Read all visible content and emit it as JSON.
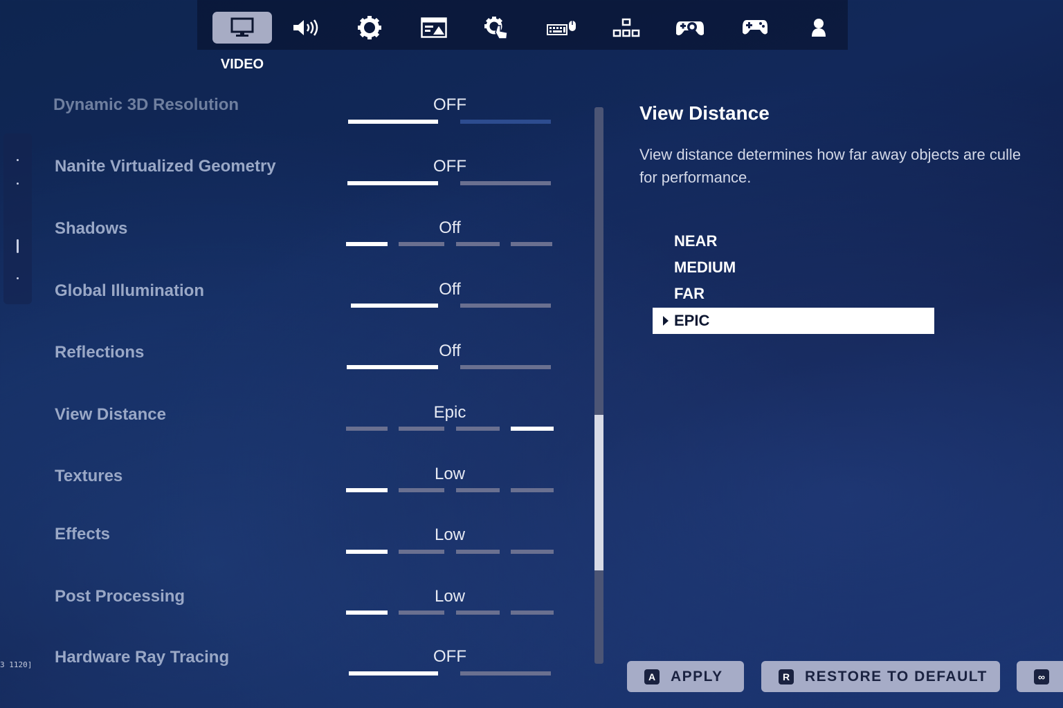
{
  "tabs": {
    "active_label": "VIDEO",
    "items": [
      {
        "icon": "monitor-icon",
        "active": true
      },
      {
        "icon": "speaker-icon",
        "active": false
      },
      {
        "icon": "gear-icon",
        "active": false
      },
      {
        "icon": "display-panel-icon",
        "active": false
      },
      {
        "icon": "touch-gear-icon",
        "active": false
      },
      {
        "icon": "keyboard-mouse-icon",
        "active": false
      },
      {
        "icon": "network-icon",
        "active": false
      },
      {
        "icon": "controller-gear-icon",
        "active": false
      },
      {
        "icon": "gamepad-icon",
        "active": false
      },
      {
        "icon": "account-icon",
        "active": false
      }
    ]
  },
  "settings": [
    {
      "label": "Dynamic 3D Resolution",
      "value": "OFF"
    },
    {
      "label": "Nanite Virtualized Geometry",
      "value": "OFF"
    },
    {
      "label": "Shadows",
      "value": "Off"
    },
    {
      "label": "Global Illumination",
      "value": "Off"
    },
    {
      "label": "Reflections",
      "value": "Off"
    },
    {
      "label": "View Distance",
      "value": "Epic"
    },
    {
      "label": "Textures",
      "value": "Low"
    },
    {
      "label": "Effects",
      "value": "Low"
    },
    {
      "label": "Post Processing",
      "value": "Low"
    },
    {
      "label": "Hardware Ray Tracing",
      "value": "OFF"
    }
  ],
  "detail": {
    "title": "View Distance",
    "description_line1": "View distance determines how far away objects are culle",
    "description_line2": "for performance.",
    "options": [
      "NEAR",
      "MEDIUM",
      "FAR"
    ],
    "selected_option": "EPIC"
  },
  "buttons": {
    "apply": {
      "key": "A",
      "label": "APPLY"
    },
    "restore": {
      "key": "R",
      "label": "RESTORE TO DEFAULT"
    },
    "third": {
      "key": "∞"
    }
  },
  "corner_text": "3 1120]",
  "colors": {
    "accent": "#a6acc7",
    "bar_on": "#ffffff",
    "bar_off": "#6a7090"
  }
}
